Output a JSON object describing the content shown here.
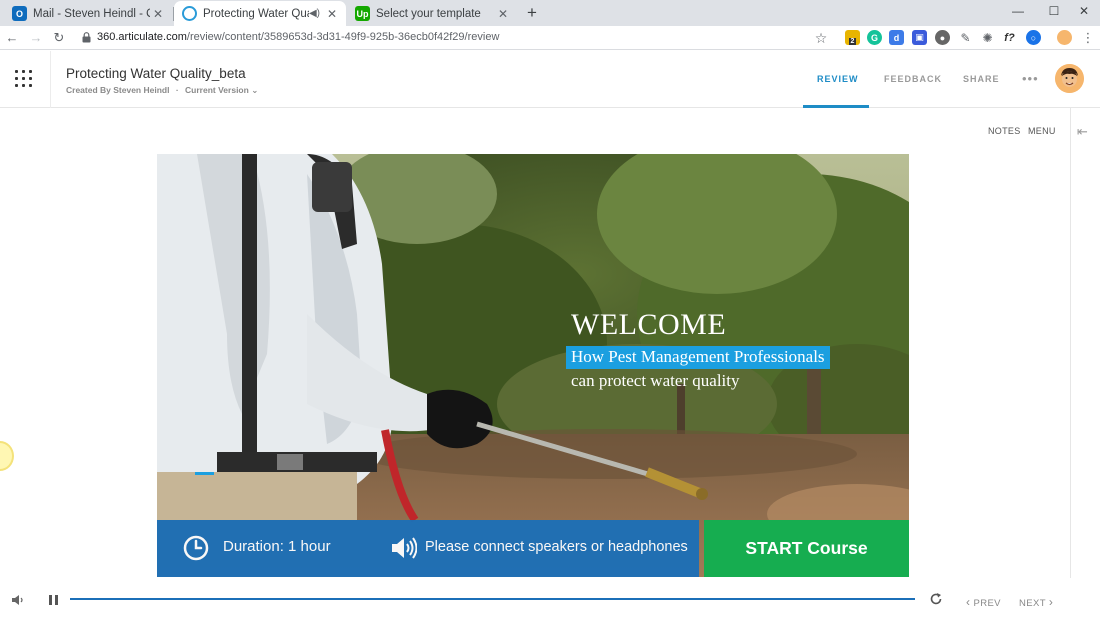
{
  "browser": {
    "tabs": [
      {
        "title": "Mail - Steven Heindl - Outlook",
        "icon": "outlook-icon",
        "active": false
      },
      {
        "title": "Protecting Water Quality_bet",
        "icon": "articulate-icon",
        "active": true
      },
      {
        "title": "Select your template",
        "icon": "upwork-icon",
        "active": false
      }
    ],
    "new_tab": "+",
    "url_host": "360.articulate.com",
    "url_path": "/review/content/3589653d-3d31-49f9-925b-36ecb0f42f29/review",
    "ext_badge": "2",
    "ext_f_label": "f?"
  },
  "app": {
    "course_title": "Protecting Water Quality_beta",
    "created_by": "Created By Steven Heindl",
    "separator": "·",
    "version": "Current Version",
    "tabs": [
      "REVIEW",
      "FEEDBACK",
      "SHARE"
    ],
    "active_tab": "REVIEW",
    "more": "•••"
  },
  "viewer": {
    "notes": "NOTES",
    "menu": "MENU"
  },
  "slide": {
    "heading": "WELCOME",
    "subheading_highlight": "How Pest Management Professionals",
    "subheading_line2": "can protect water quality",
    "duration": "Duration: 1 hour",
    "speakers_notice": "Please connect speakers or headphones",
    "start_button": "START Course",
    "colors": {
      "accent_blue": "#1b9fe0",
      "bar_blue": "#1b6fb8",
      "start_green": "#16ad50"
    }
  },
  "player": {
    "prev": "PREV",
    "next": "NEXT"
  }
}
